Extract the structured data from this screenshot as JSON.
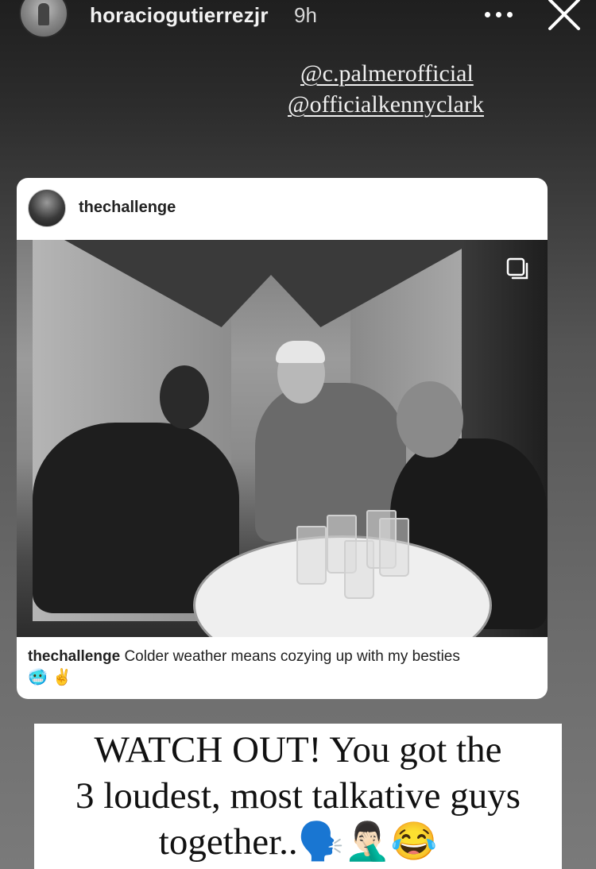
{
  "story": {
    "username": "horaciogutierrezjr",
    "time_ago": "9h"
  },
  "mentions": [
    "@c.palmerofficial",
    "@officialkennyclark"
  ],
  "shared_post": {
    "username": "thechallenge",
    "caption_user": "thechallenge",
    "caption_text": "Colder weather means cozying up with my besties",
    "caption_emoji": "🥶 ✌️"
  },
  "story_text": {
    "line1": "WATCH OUT! You got the",
    "line2": "3 loudest, most talkative guys",
    "line3": "together..🗣️🤦🏻‍♂️😂"
  },
  "icons": {
    "more": "more-horizontal-icon",
    "close": "close-icon",
    "multi": "multiple-photos-icon"
  }
}
